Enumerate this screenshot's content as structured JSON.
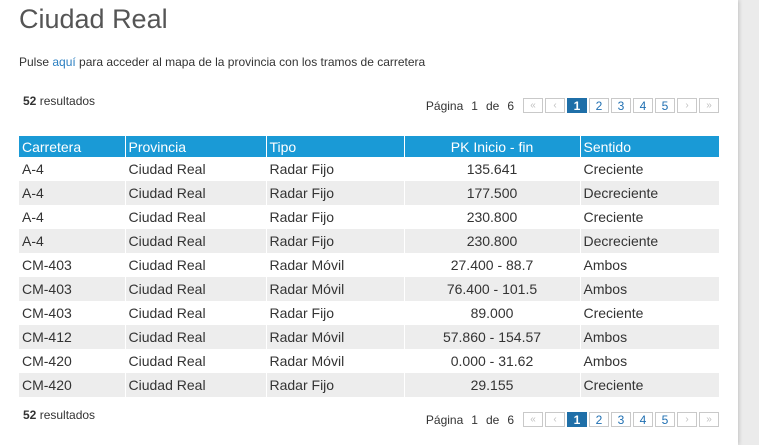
{
  "page": {
    "title": "Ciudad Real",
    "intro_before": "Pulse ",
    "intro_link": "aquí",
    "intro_after": " para acceder al mapa de la provincia con los tramos de carretera"
  },
  "results": {
    "count": "52",
    "label": " resultados"
  },
  "pagination": {
    "label": "Página",
    "current": "1",
    "of": "de",
    "total": "6",
    "first": "«",
    "prev": "‹",
    "next": "›",
    "last": "»",
    "pages": [
      "1",
      "2",
      "3",
      "4",
      "5"
    ]
  },
  "table": {
    "columns": [
      "Carretera",
      "Provincia",
      "Tipo",
      "PK Inicio - fin",
      "Sentido"
    ],
    "rows": [
      [
        "A-4",
        "Ciudad Real",
        "Radar Fijo",
        "135.641",
        "Creciente"
      ],
      [
        "A-4",
        "Ciudad Real",
        "Radar Fijo",
        "177.500",
        "Decreciente"
      ],
      [
        "A-4",
        "Ciudad Real",
        "Radar Fijo",
        "230.800",
        "Creciente"
      ],
      [
        "A-4",
        "Ciudad Real",
        "Radar Fijo",
        "230.800",
        "Decreciente"
      ],
      [
        "CM-403",
        "Ciudad Real",
        "Radar Móvil",
        "27.400 - 88.7",
        "Ambos"
      ],
      [
        "CM-403",
        "Ciudad Real",
        "Radar Móvil",
        "76.400 - 101.5",
        "Ambos"
      ],
      [
        "CM-403",
        "Ciudad Real",
        "Radar Fijo",
        "89.000",
        "Creciente"
      ],
      [
        "CM-412",
        "Ciudad Real",
        "Radar Móvil",
        "57.860 - 154.57",
        "Ambos"
      ],
      [
        "CM-420",
        "Ciudad Real",
        "Radar Móvil",
        "0.000 - 31.62",
        "Ambos"
      ],
      [
        "CM-420",
        "Ciudad Real",
        "Radar Fijo",
        "29.155",
        "Creciente"
      ]
    ]
  },
  "colors": {
    "header_bg": "#1a9ad6",
    "active_page_bg": "#1f6fa8",
    "link": "#2b7fc1",
    "row_alt": "#ededed"
  }
}
